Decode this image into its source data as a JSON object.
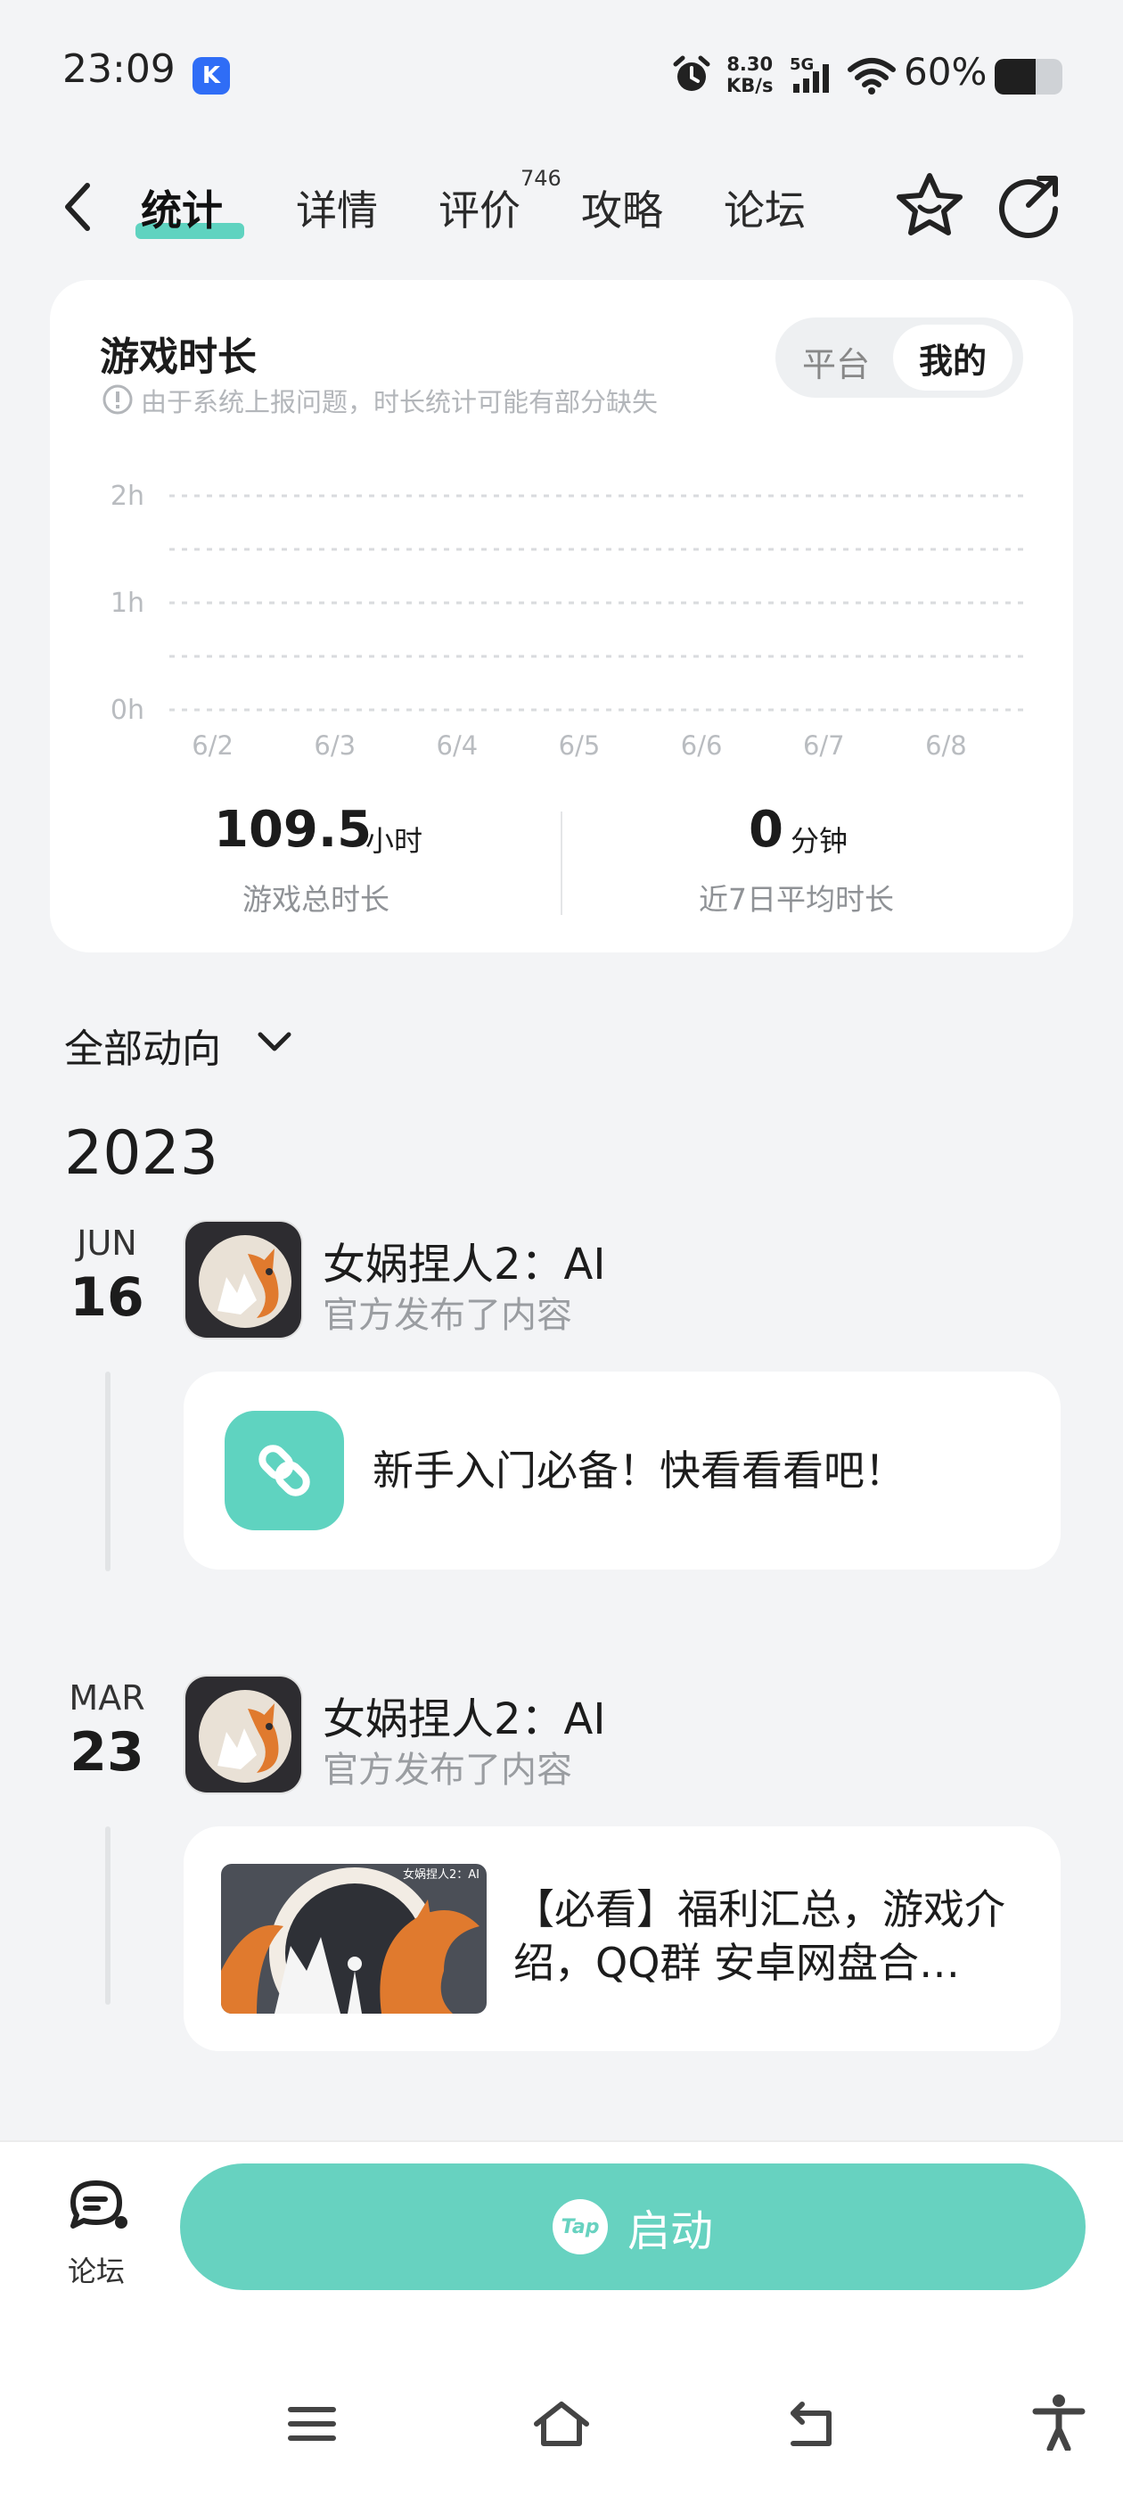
{
  "status_bar": {
    "time": "23:09",
    "k_badge": "K",
    "net_speed_value": "8.30",
    "net_speed_unit": "KB/s",
    "network": "5G",
    "battery": "60%",
    "battery_level": 0.6
  },
  "nav": {
    "tabs": [
      {
        "label": "统计",
        "active": true
      },
      {
        "label": "详情",
        "active": false
      },
      {
        "label": "评价",
        "active": false
      },
      {
        "label": "攻略",
        "active": false
      },
      {
        "label": "论坛",
        "active": false
      }
    ],
    "review_count": "746",
    "icons": [
      "back-icon",
      "star-icon",
      "share-icon"
    ]
  },
  "playtime": {
    "title": "游戏时长",
    "note": "由于系统上报问题，时长统计可能有部分缺失",
    "toggle": {
      "platform": "平台",
      "mine": "我的",
      "selected": "我的"
    },
    "total_value": "109.5",
    "total_unit": "小时",
    "total_label": "游戏总时长",
    "avg_value": "0",
    "avg_unit": "分钟",
    "avg_label": "近7日平均时长"
  },
  "chart_data": {
    "type": "bar",
    "categories": [
      "6/2",
      "6/3",
      "6/4",
      "6/5",
      "6/6",
      "6/7",
      "6/8"
    ],
    "values": [
      0,
      0,
      0,
      0,
      0,
      0,
      0
    ],
    "ytick_labels": [
      "2h",
      "1h",
      "0h"
    ],
    "ylim": [
      0,
      2
    ],
    "grid": true,
    "accent": "#5fd3c0"
  },
  "feed": {
    "filter_label": "全部动向",
    "year": "2023",
    "entries": [
      {
        "month": "JUN",
        "day": "16",
        "title": "女娲捏人2：AI",
        "subtitle": "官方发布了内容",
        "post_text": "新手入门必备！快看看看吧！",
        "post_type": "link"
      },
      {
        "month": "MAR",
        "day": "23",
        "title": "女娲捏人2：AI",
        "subtitle": "官方发布了内容",
        "post_text_line1": "【必看】福利汇总，游戏介",
        "post_text_line2": "绍，QQ群 安卓网盘合…",
        "thumb_caption": "女娲捏人2：AI",
        "post_type": "image"
      }
    ]
  },
  "bottom": {
    "forum_label": "论坛",
    "launch_label": "启动",
    "tap_logo": "Tap"
  },
  "colors": {
    "accent": "#5fd3c0",
    "launch": "#67d2c0",
    "background": "#f3f4f6"
  }
}
